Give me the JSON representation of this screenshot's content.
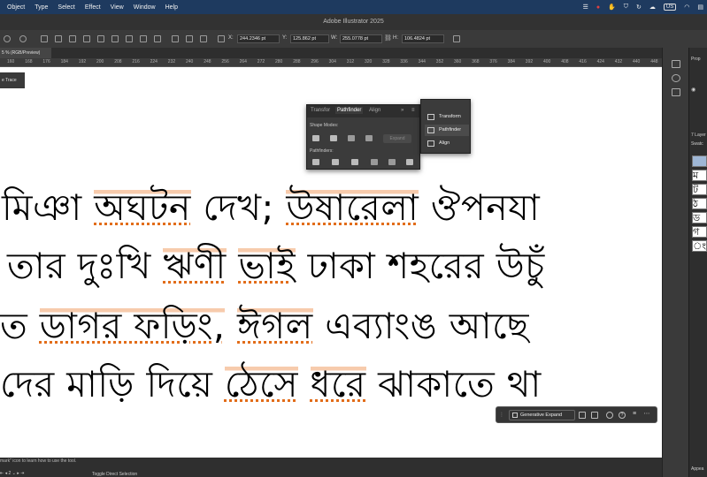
{
  "menubar": {
    "items": [
      "Object",
      "Type",
      "Select",
      "Effect",
      "View",
      "Window",
      "Help"
    ],
    "status_badge": "US"
  },
  "window": {
    "title": "Adobe Illustrator 2025"
  },
  "controlbar": {
    "x_label": "X:",
    "x_value": "244.2346 pt",
    "y_label": "Y:",
    "y_value": "125.862 pt",
    "w_label": "W:",
    "w_value": "255.0778 pt",
    "h_label": "H:",
    "h_value": "106.4824 pt"
  },
  "document_tab": {
    "label": "5 % (RGB/Preview)"
  },
  "ruler": {
    "ticks": [
      "160",
      "168",
      "176",
      "184",
      "192",
      "200",
      "208",
      "216",
      "224",
      "232",
      "240",
      "248",
      "256",
      "264",
      "272",
      "280",
      "288",
      "296",
      "304",
      "312",
      "320",
      "328",
      "336",
      "344",
      "352",
      "360",
      "368",
      "376",
      "384",
      "392",
      "400",
      "408",
      "416",
      "424",
      "432",
      "440",
      "448"
    ]
  },
  "left_chip": {
    "label": "e Trace"
  },
  "canvas": {
    "lines": [
      {
        "pre": "মিঞা ",
        "hl": "অঘটন",
        "mid": " দেখ; ",
        "hl2": "উষারেলা",
        "post": " ঔপনযা"
      },
      {
        "pre": "তার দুঃখি ",
        "hl": "ঋণী",
        "mid": " ",
        "hl2": "ভাই",
        "post": " ঢাকা শহরের উচুঁ"
      },
      {
        "pre": "ত ",
        "hl": "ডাগর ফড়িং,",
        "mid": " ",
        "hl2": "ঈগল",
        "post": " এব্যাংঙ আছে"
      },
      {
        "pre": "দের মাড়ি দিয়ে ",
        "hl": "ঠেসে",
        "mid": " ",
        "hl2": "ধরে",
        "post": " ঝাকাতে থা"
      }
    ]
  },
  "pathfinder_panel": {
    "tabs": [
      "Transfor",
      "Pathfinder",
      "Align"
    ],
    "shape_modes_label": "Shape Modes:",
    "expand_label": "Expand",
    "pathfinders_label": "Pathfinders:"
  },
  "panel_menu": {
    "items": [
      "Transform",
      "Pathfinder",
      "Align"
    ]
  },
  "contextual_bar": {
    "generative_expand": "Generative Expand",
    "help": "?"
  },
  "statusbar": {
    "hint": "mark\" icon to learn how to use the tool.",
    "zoom": "2",
    "toggle": "Toggle Direct Selection"
  },
  "right_panel": {
    "prop_label": "Prop",
    "layers_label": "7 Layer",
    "swatch_label": "Swatc",
    "appearance_label": "Appea",
    "glyphs": [
      "ম",
      "ট",
      "ঠ",
      "ড",
      "গ",
      "ং"
    ]
  },
  "colors": {
    "highlight": "#e26d1a",
    "menubar": "#1e3a5f"
  }
}
